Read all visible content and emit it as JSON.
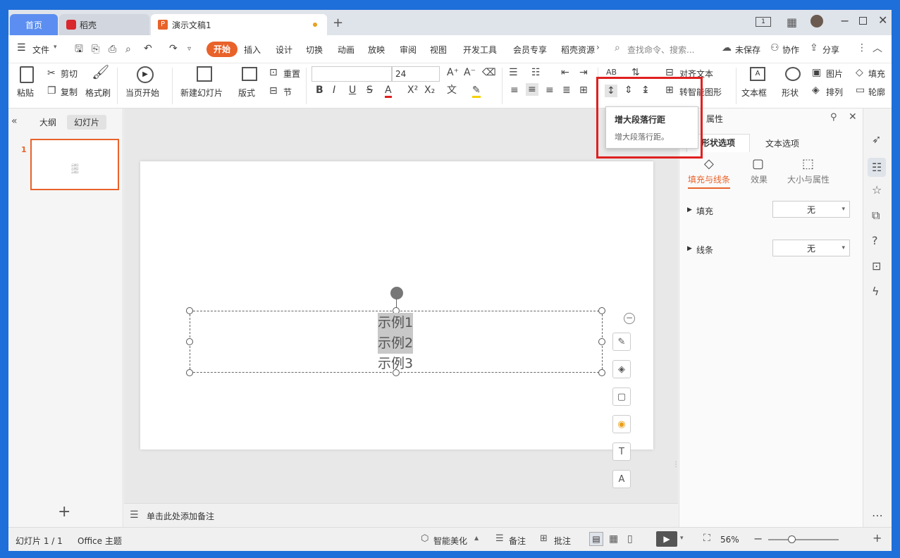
{
  "tabs": {
    "home": "首页",
    "daoke": "稻壳",
    "doc": "演示文稿1",
    "add": "+"
  },
  "menu": {
    "file": "文件",
    "start": "开始",
    "items": [
      "插入",
      "设计",
      "切换",
      "动画",
      "放映",
      "审阅",
      "视图",
      "开发工具",
      "会员专享",
      "稻壳资源"
    ],
    "search": "查找命令、搜索...",
    "unsaved": "未保存",
    "collab": "协作",
    "share": "分享"
  },
  "ribbon": {
    "paste": "粘贴",
    "cut": "剪切",
    "copy": "复制",
    "format_painter": "格式刷",
    "play_from_current": "当页开始",
    "new_slide": "新建幻灯片",
    "layout": "版式",
    "reset": "重置",
    "section": "节",
    "font_name": "",
    "font_size": "24",
    "align_text": "对齐文本",
    "smart_shape": "转智能图形",
    "textbox": "文本框",
    "shape": "形状",
    "picture": "图片",
    "arrange": "排列",
    "fill": "填充",
    "outline": "轮廓"
  },
  "tooltip": {
    "title": "增大段落行距",
    "desc": "增大段落行距。"
  },
  "left": {
    "outline": "大纲",
    "slides": "幻灯片",
    "slide_num": "1",
    "thumb_lines": [
      "示例1",
      "示例2",
      "示例3"
    ],
    "add": "+"
  },
  "slide": {
    "lines": [
      "示例1",
      "示例2",
      "示例3"
    ]
  },
  "notes": {
    "placeholder": "单击此处添加备注"
  },
  "panel": {
    "title": "属性",
    "tab_shape": "形状选项",
    "tab_text": "文本选项",
    "sub_fill": "填充与线条",
    "sub_effect": "效果",
    "sub_size": "大小与属性",
    "fill_label": "填充",
    "fill_value": "无",
    "line_label": "线条",
    "line_value": "无"
  },
  "status": {
    "slide_info": "幻灯片 1 / 1",
    "theme": "Office 主题",
    "beautify": "智能美化",
    "notes": "备注",
    "comments": "批注",
    "zoom": "56%"
  },
  "colors": {
    "accent": "#e8622a",
    "highlight": "#e02020",
    "tab_blue": "#5b8ef0"
  }
}
